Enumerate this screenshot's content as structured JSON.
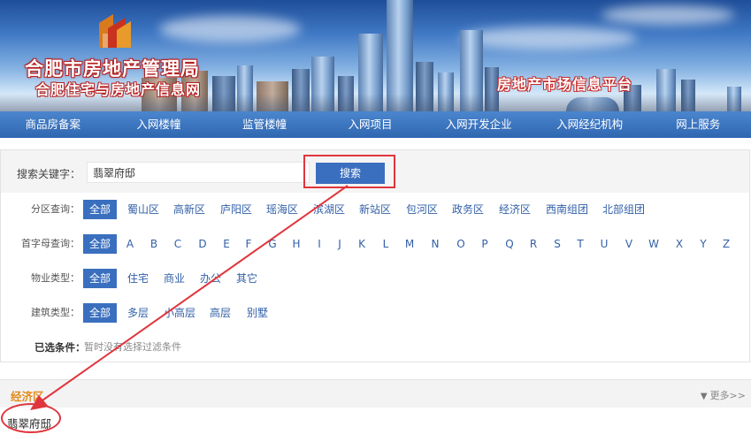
{
  "header": {
    "title": "合肥市房地产管理局",
    "subtitle": "合肥住宅与房地产信息网",
    "platform": "房地产市场信息平台"
  },
  "nav": {
    "items": [
      "商品房备案",
      "入网楼幢",
      "监管楼幢",
      "入网项目",
      "入网开发企业",
      "入网经纪机构",
      "网上服务"
    ]
  },
  "search": {
    "label": "搜索关键字：",
    "value": "翡翠府邸",
    "button": "搜索"
  },
  "filters": {
    "district": {
      "label": "分区查询：",
      "selected": "全部",
      "options": [
        "蜀山区",
        "高新区",
        "庐阳区",
        "瑶海区",
        "滨湖区",
        "新站区",
        "包河区",
        "政务区",
        "经济区",
        "西南组团",
        "北部组团"
      ]
    },
    "initial": {
      "label": "首字母查询：",
      "selected": "全部",
      "options": [
        "A",
        "B",
        "C",
        "D",
        "E",
        "F",
        "G",
        "H",
        "I",
        "J",
        "K",
        "L",
        "M",
        "N",
        "O",
        "P",
        "Q",
        "R",
        "S",
        "T",
        "U",
        "V",
        "W",
        "X",
        "Y",
        "Z"
      ]
    },
    "property_type": {
      "label": "物业类型：",
      "selected": "全部",
      "options": [
        "住宅",
        "商业",
        "办公",
        "其它"
      ]
    },
    "building_type": {
      "label": "建筑类型：",
      "selected": "全部",
      "options": [
        "多层",
        "小高层",
        "高层",
        "别墅"
      ]
    },
    "conditions": {
      "label": "已选条件：",
      "text": "暂时没有选择过滤条件"
    }
  },
  "result": {
    "section_title": "经济区",
    "more": "更多>>",
    "items": [
      "翡翠府邸"
    ]
  },
  "colors": {
    "nav_bg": "#2f66b1",
    "accent": "#3a6fbf",
    "annotation": "#e0353d",
    "section_title": "#e38a1d"
  }
}
